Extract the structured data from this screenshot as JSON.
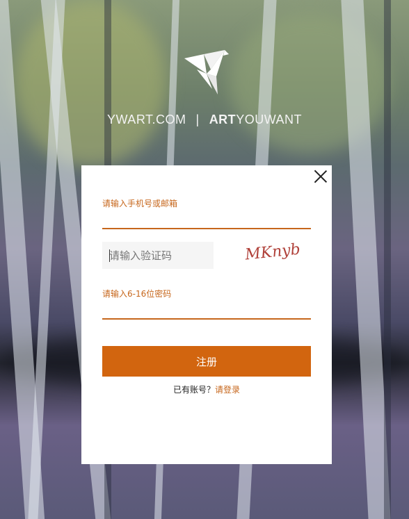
{
  "brand": {
    "site": "YWART.COM",
    "separator": "|",
    "art": "ART",
    "rest": "YOUWANT"
  },
  "form": {
    "phone_label": "请输入手机号或邮箱",
    "code_placeholder": "请输入验证码",
    "captcha_text": "MKnyb",
    "password_label": "请输入6-16位密码",
    "register_label": "注册",
    "have_account": "已有账号？",
    "login_link": "请登录"
  },
  "colors": {
    "accent": "#d2650f",
    "label": "#c6661b"
  },
  "icons": {
    "logo": "origami-bird-icon",
    "close": "close-icon"
  }
}
